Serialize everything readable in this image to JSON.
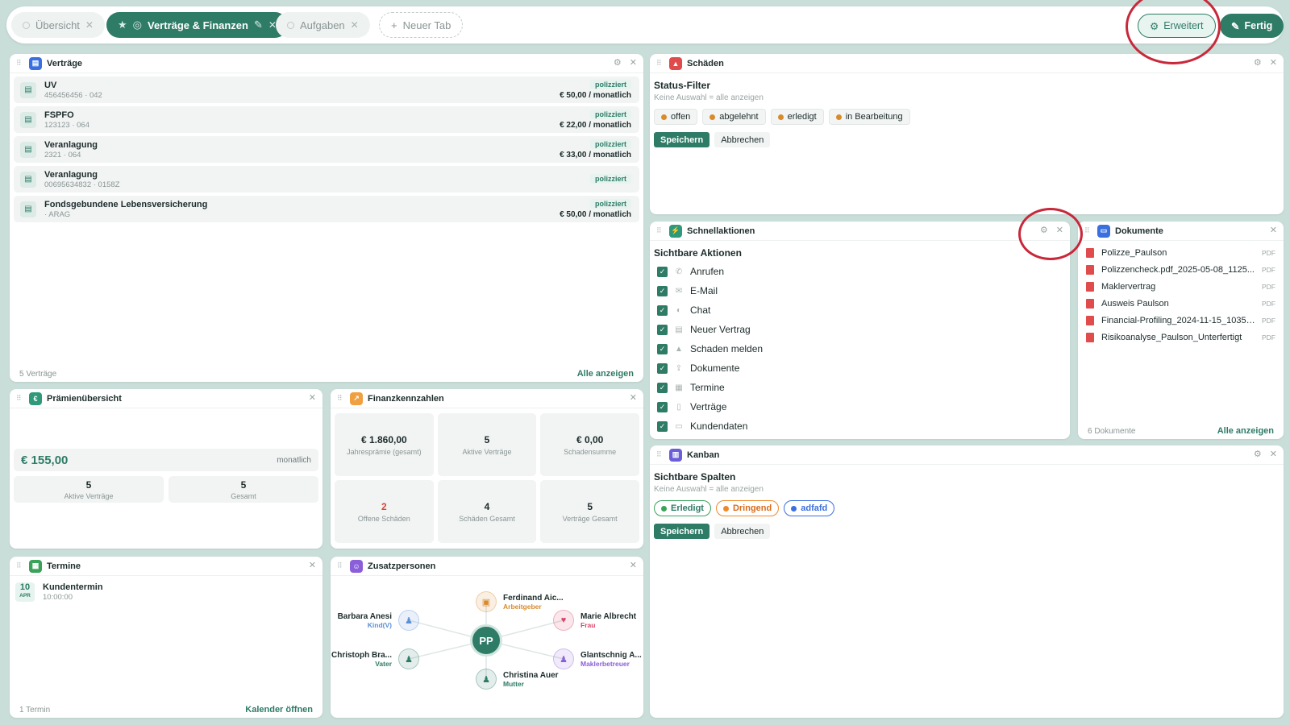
{
  "tabs": [
    {
      "label": "Übersicht"
    },
    {
      "label": "Verträge & Finanzen"
    },
    {
      "label": "Aufgaben"
    },
    {
      "label": "Neuer Tab"
    }
  ],
  "toolbar": {
    "erweitert": "Erweitert",
    "fertig": "Fertig"
  },
  "colors": {
    "accent": "#2e7b66",
    "annotation": "#c8283a",
    "background": "#c9ddd9"
  },
  "vertraege": {
    "title": "Verträge",
    "rows": [
      {
        "name": "UV",
        "sub": "456456456 · 042",
        "badge": "polizziert",
        "price": "€ 50,00 / monatlich"
      },
      {
        "name": "FSPFO",
        "sub": "123123 · 064",
        "badge": "polizziert",
        "price": "€ 22,00 / monatlich"
      },
      {
        "name": "Veranlagung",
        "sub": "2321 · 064",
        "badge": "polizziert",
        "price": "€ 33,00 / monatlich"
      },
      {
        "name": "Veranlagung",
        "sub": "00695634832 · 0158Z",
        "badge": "polizziert",
        "price": ""
      },
      {
        "name": "Fondsgebundene Lebensversicherung",
        "sub": "· ARAG",
        "badge": "polizziert",
        "price": "€ 50,00 / monatlich"
      }
    ],
    "footer_count": "5 Verträge",
    "footer_link": "Alle anzeigen"
  },
  "schaeden": {
    "title": "Schäden",
    "filter_title": "Status-Filter",
    "filter_sub": "Keine Auswahl = alle anzeigen",
    "chips": [
      {
        "label": "offen",
        "color": "#d98a2b"
      },
      {
        "label": "abgelehnt",
        "color": "#d98a2b"
      },
      {
        "label": "erledigt",
        "color": "#d98a2b"
      },
      {
        "label": "in Bearbeitung",
        "color": "#d98a2b"
      }
    ],
    "save": "Speichern",
    "cancel": "Abbrechen"
  },
  "schnell": {
    "title": "Schnellaktionen",
    "section": "Sichtbare Aktionen",
    "items": [
      {
        "label": "Anrufen",
        "icon": "phone-icon"
      },
      {
        "label": "E-Mail",
        "icon": "mail-icon"
      },
      {
        "label": "Chat",
        "icon": "chat-icon"
      },
      {
        "label": "Neuer Vertrag",
        "icon": "contract-icon"
      },
      {
        "label": "Schaden melden",
        "icon": "warning-icon"
      },
      {
        "label": "Dokumente",
        "icon": "upload-icon"
      },
      {
        "label": "Termine",
        "icon": "calendar-icon"
      },
      {
        "label": "Verträge",
        "icon": "file-icon"
      },
      {
        "label": "Kundendaten",
        "icon": "id-card-icon"
      }
    ]
  },
  "dokumente": {
    "title": "Dokumente",
    "items": [
      {
        "name": "Polizze_Paulson",
        "ext": "PDF"
      },
      {
        "name": "Polizzencheck.pdf_2025-05-08_1125...",
        "ext": "PDF"
      },
      {
        "name": "Maklervertrag",
        "ext": "PDF"
      },
      {
        "name": "Ausweis Paulson",
        "ext": "PDF"
      },
      {
        "name": "Financial-Profiling_2024-11-15_10352...",
        "ext": "PDF"
      },
      {
        "name": "Risikoanalyse_Paulson_Unterfertigt",
        "ext": "PDF"
      }
    ],
    "footer_count": "6 Dokumente",
    "footer_link": "Alle anzeigen"
  },
  "praemien": {
    "title": "Prämienübersicht",
    "amount": "€ 155,00",
    "period": "monatlich",
    "stats": [
      {
        "value": "5",
        "label": "Aktive Verträge"
      },
      {
        "value": "5",
        "label": "Gesamt"
      }
    ]
  },
  "finanz": {
    "title": "Finanzkennzahlen",
    "cells": [
      {
        "value": "€ 1.860,00",
        "label": "Jahresprämie (gesamt)"
      },
      {
        "value": "5",
        "label": "Aktive Verträge"
      },
      {
        "value": "€ 0,00",
        "label": "Schadensumme"
      },
      {
        "value": "2",
        "label": "Offene Schäden"
      },
      {
        "value": "4",
        "label": "Schäden Gesamt"
      },
      {
        "value": "5",
        "label": "Verträge Gesamt"
      }
    ]
  },
  "kanban": {
    "title": "Kanban",
    "section": "Sichtbare Spalten",
    "sub": "Keine Auswahl = alle anzeigen",
    "chips": [
      {
        "label": "Erledigt",
        "color": "#3aa35a",
        "text": "#2e7b66"
      },
      {
        "label": "Dringend",
        "color": "#f0882a",
        "text": "#d96b1a"
      },
      {
        "label": "adfafd",
        "color": "#3a6fe0",
        "text": "#3a6fe0"
      }
    ],
    "save": "Speichern",
    "cancel": "Abbrechen"
  },
  "termine": {
    "title": "Termine",
    "items": [
      {
        "day": "10",
        "month": "APR",
        "name": "Kundentermin",
        "time": "10:00:00"
      }
    ],
    "footer_count": "1 Termin",
    "footer_link": "Kalender öffnen"
  },
  "zusatz": {
    "title": "Zusatzpersonen",
    "center": "PP",
    "people": [
      {
        "name": "Ferdinand Aic...",
        "role": "Arbeitgeber",
        "color": "#d98a2b",
        "icon": "briefcase-icon"
      },
      {
        "name": "Marie Albrecht",
        "role": "Frau",
        "color": "#d9456a",
        "icon": "heart-icon"
      },
      {
        "name": "Glantschnig A...",
        "role": "Maklerbetreuer",
        "color": "#8b5fd9",
        "icon": "person-icon"
      },
      {
        "name": "Christina Auer",
        "role": "Mutter",
        "color": "#2e7b66",
        "icon": "person-icon"
      },
      {
        "name": "Christoph Bra...",
        "role": "Vater",
        "color": "#2e7b66",
        "icon": "person-icon"
      },
      {
        "name": "Barbara Anesi",
        "role": "Kind(V)",
        "color": "#5b8fd9",
        "icon": "person-icon"
      }
    ]
  }
}
